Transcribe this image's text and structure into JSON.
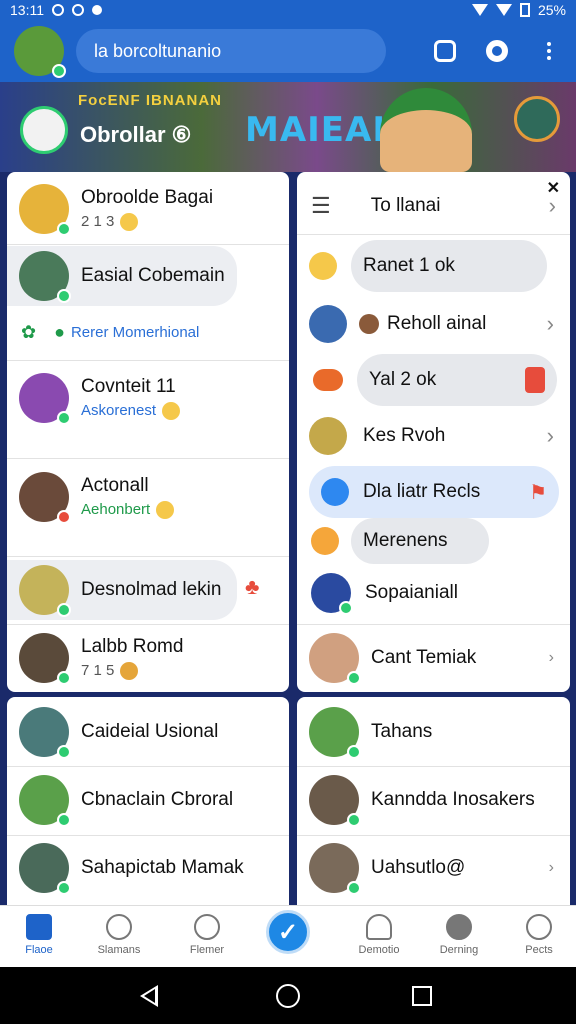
{
  "status_bar": {
    "time": "13:11",
    "battery": "25%"
  },
  "app_bar": {
    "search_text": "la borcoltunanio"
  },
  "banner": {
    "subtitle": "FocENF IBNANAN",
    "art_text": "MAIEAH",
    "title": "Obrollar ⑥"
  },
  "left_panel": {
    "rows": [
      {
        "name": "Obroolde Bagai",
        "sub": "2 1 3"
      },
      {
        "name": "Easial Cobemain",
        "sub": ""
      },
      {
        "name": "",
        "sub": "Rerer Momerhional"
      },
      {
        "name": "Covnteit 11",
        "sub": "Askorenest"
      },
      {
        "name": "Actonall",
        "sub": "Aehonbert"
      },
      {
        "name": "Desnolmad lekin",
        "sub": ""
      },
      {
        "name": "Lalbb Romd",
        "sub": "7 1 5"
      }
    ]
  },
  "right_panel": {
    "header": "To llanai",
    "rows": [
      {
        "name": "Ranet 1 ok"
      },
      {
        "name": "Reholl ainal"
      },
      {
        "name": "Yal 2 ok"
      },
      {
        "name": "Kes Rvoh"
      },
      {
        "name": "Dla liatr Recls"
      },
      {
        "name": "Merenens"
      },
      {
        "name": "Sopaianiall"
      },
      {
        "name": "Cant Temiak"
      }
    ]
  },
  "left_lower": {
    "rows": [
      {
        "name": "Caideial Usional"
      },
      {
        "name": "Cbnaclain Cbroral"
      },
      {
        "name": "Sahapictab Mamak"
      }
    ]
  },
  "right_lower": {
    "rows": [
      {
        "name": "Tahans"
      },
      {
        "name": "Kanndda Inosakers"
      },
      {
        "name": "Uahsutlo@"
      }
    ]
  },
  "bottom_nav": {
    "items": [
      {
        "label": "Flaoe"
      },
      {
        "label": "Slamans"
      },
      {
        "label": "Flemer"
      },
      {
        "label": "Demotio"
      },
      {
        "label": "Derning"
      },
      {
        "label": "Pects"
      }
    ],
    "fab_icon": "check-icon"
  },
  "colors": {
    "primary": "#1e63c9",
    "accent": "#1e88e5",
    "panel": "#ffffff"
  }
}
